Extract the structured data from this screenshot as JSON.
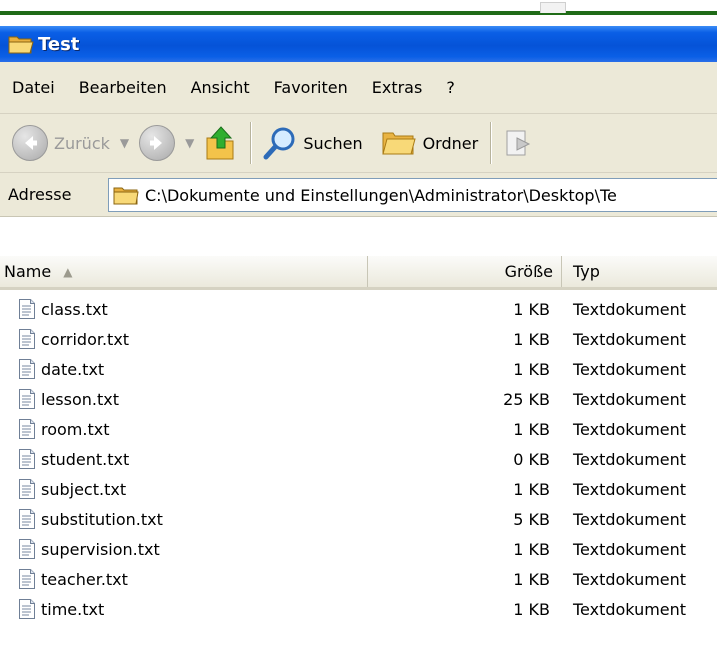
{
  "window": {
    "title": "Test"
  },
  "menu": {
    "items": [
      "Datei",
      "Bearbeiten",
      "Ansicht",
      "Favoriten",
      "Extras",
      "?"
    ]
  },
  "toolbar": {
    "back_label": "Zurück",
    "search_label": "Suchen",
    "folders_label": "Ordner"
  },
  "address": {
    "label": "Adresse",
    "path": "C:\\Dokumente und Einstellungen\\Administrator\\Desktop\\Te"
  },
  "columns": {
    "name": "Name",
    "size": "Größe",
    "type": "Typ"
  },
  "files": [
    {
      "name": "class.txt",
      "size": "1 KB",
      "type": "Textdokument"
    },
    {
      "name": "corridor.txt",
      "size": "1 KB",
      "type": "Textdokument"
    },
    {
      "name": "date.txt",
      "size": "1 KB",
      "type": "Textdokument"
    },
    {
      "name": "lesson.txt",
      "size": "25 KB",
      "type": "Textdokument"
    },
    {
      "name": "room.txt",
      "size": "1 KB",
      "type": "Textdokument"
    },
    {
      "name": "student.txt",
      "size": "0 KB",
      "type": "Textdokument"
    },
    {
      "name": "subject.txt",
      "size": "1 KB",
      "type": "Textdokument"
    },
    {
      "name": "substitution.txt",
      "size": "5 KB",
      "type": "Textdokument"
    },
    {
      "name": "supervision.txt",
      "size": "1 KB",
      "type": "Textdokument"
    },
    {
      "name": "teacher.txt",
      "size": "1 KB",
      "type": "Textdokument"
    },
    {
      "name": "time.txt",
      "size": "1 KB",
      "type": "Textdokument"
    }
  ],
  "colors": {
    "titlebar": "#0553d8",
    "chrome": "#ece9d8",
    "folder": "#f6c650"
  }
}
